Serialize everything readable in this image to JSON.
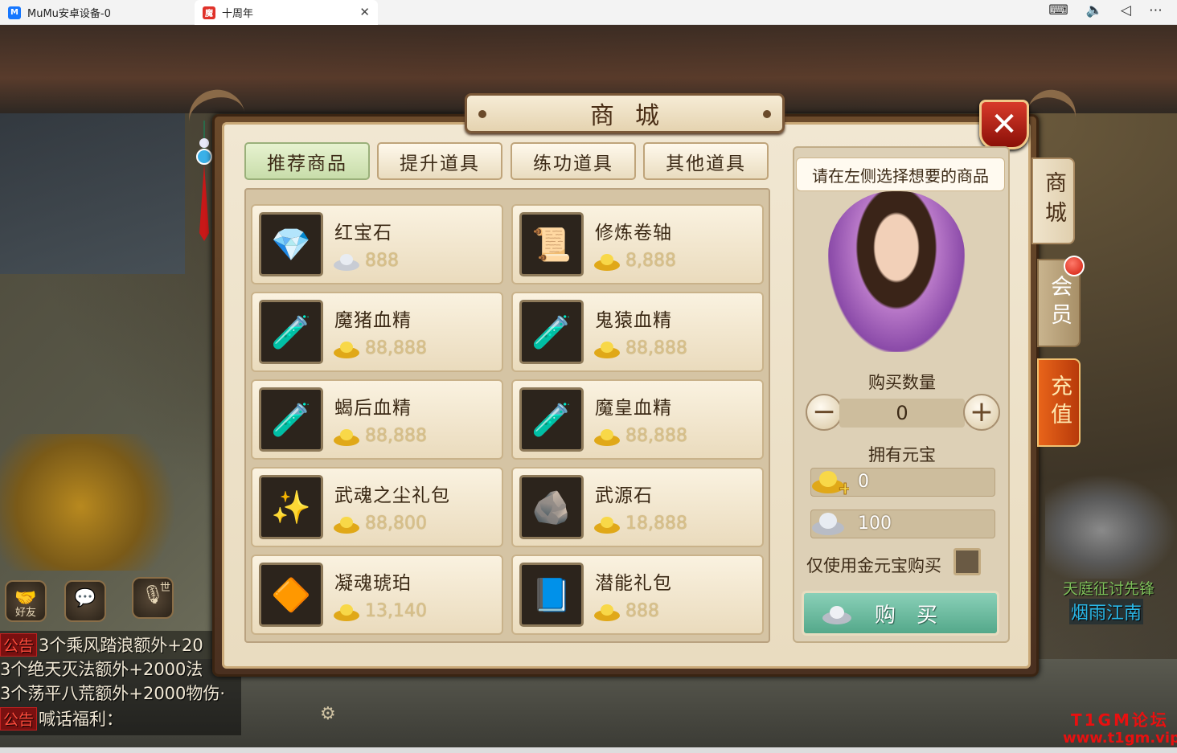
{
  "window": {
    "tabs": [
      {
        "label": "MuMu安卓设备-0",
        "icon": "mumu-icon"
      },
      {
        "label": "十周年",
        "icon": "game-icon"
      }
    ],
    "system_icons": [
      "keyboard-icon",
      "volume-icon",
      "back-icon",
      "more-icon"
    ]
  },
  "shop": {
    "title": "商城",
    "categories": [
      "推荐商品",
      "提升道具",
      "练功道具",
      "其他道具"
    ],
    "active_category": 0,
    "items": [
      {
        "name": "红宝石",
        "price": "888",
        "currency": "silver"
      },
      {
        "name": "修炼卷轴",
        "price": "8,888",
        "currency": "gold"
      },
      {
        "name": "魔猪血精",
        "price": "88,888",
        "currency": "gold"
      },
      {
        "name": "鬼猿血精",
        "price": "88,888",
        "currency": "gold"
      },
      {
        "name": "蝎后血精",
        "price": "88,888",
        "currency": "gold"
      },
      {
        "name": "魔皇血精",
        "price": "88,888",
        "currency": "gold"
      },
      {
        "name": "武魂之尘礼包",
        "price": "88,800",
        "currency": "gold"
      },
      {
        "name": "武源石",
        "price": "18,888",
        "currency": "gold"
      },
      {
        "name": "凝魂琥珀",
        "price": "13,140",
        "currency": "gold"
      },
      {
        "name": "潜能礼包",
        "price": "888",
        "currency": "gold"
      }
    ],
    "right_panel": {
      "hint": "请在左侧选择想要的商品",
      "quantity_label": "购买数量",
      "quantity": "0",
      "owned_label": "拥有元宝",
      "gold_amount": "0",
      "silver_amount": "100",
      "gold_only_label": "仅使用金元宝购买",
      "buy_label": "购买"
    },
    "side_tabs": [
      {
        "label": "商城"
      },
      {
        "label": "会员"
      },
      {
        "label": "充值"
      }
    ]
  },
  "hud": {
    "friend_label": "好友",
    "world_label": "世",
    "chat": [
      {
        "tag": "公告",
        "text": "3个乘风踏浪额外+20"
      },
      {
        "tag": "",
        "text": "3个绝天灭法额外+2000法"
      },
      {
        "tag": "",
        "text": "3个荡平八荒额外+2000物伤·"
      },
      {
        "tag": "公告",
        "text": "喊话福利："
      }
    ]
  },
  "scene": {
    "npc_title": "天庭征讨先锋",
    "npc_name": "烟雨江南",
    "watermark_line1": "T1GM论坛",
    "watermark_line2": "www.t1gm.vip"
  }
}
